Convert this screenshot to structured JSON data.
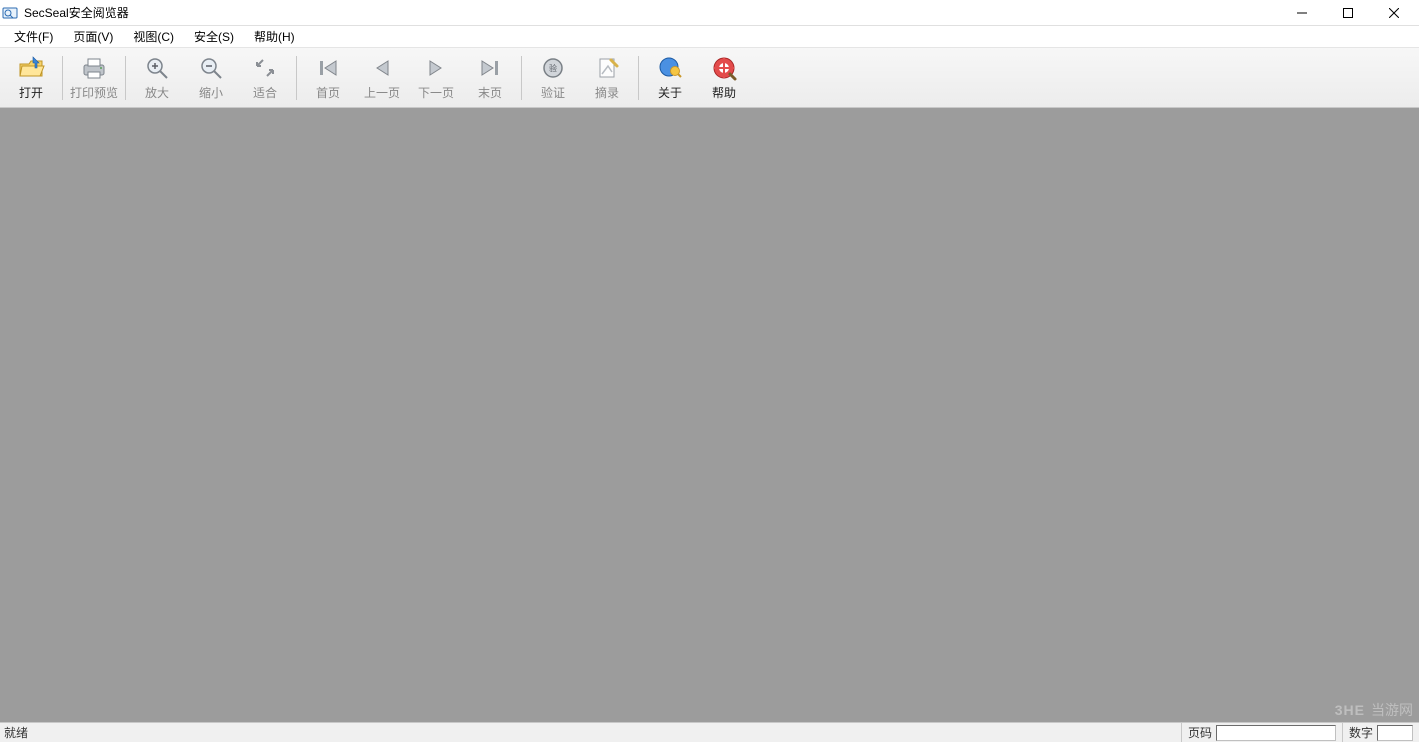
{
  "window": {
    "title": "SecSeal安全阅览器"
  },
  "menubar": {
    "items": [
      {
        "label": "文件(F)"
      },
      {
        "label": "页面(V)"
      },
      {
        "label": "视图(C)"
      },
      {
        "label": "安全(S)"
      },
      {
        "label": "帮助(H)"
      }
    ]
  },
  "toolbar": {
    "open": "打开",
    "print_preview": "打印预览",
    "zoom_in": "放大",
    "zoom_out": "缩小",
    "fit": "适合",
    "first_page": "首页",
    "prev_page": "上一页",
    "next_page": "下一页",
    "last_page": "末页",
    "verify": "验证",
    "extract": "摘录",
    "about": "关于",
    "help": "帮助"
  },
  "statusbar": {
    "ready": "就绪",
    "page_label": "页码",
    "page_value": "",
    "num_label": "数字",
    "num_value": ""
  },
  "watermark": {
    "logo": "3HE",
    "text": "当游网"
  }
}
